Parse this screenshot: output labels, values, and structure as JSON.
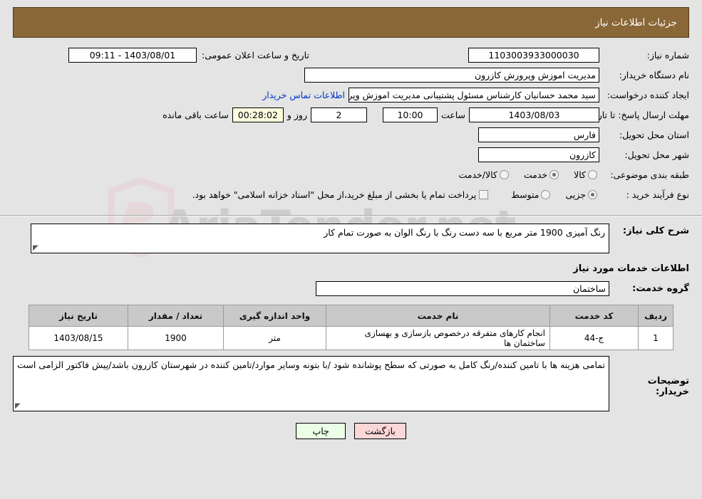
{
  "header": {
    "title": "جزئیات اطلاعات نیاز"
  },
  "colors": {
    "header_bg": "#8a6736",
    "page_bg": "#e4e4e4",
    "link": "#0033cc",
    "countdown_bg": "#ffffe0",
    "table_header_bg": "#c9c9c9",
    "print_button_bg": "#eaffe6",
    "back_button_bg": "#fcd7d7"
  },
  "info": {
    "need_number_label": "شماره نیاز:",
    "need_number_value": "1103003933000030",
    "announce_datetime_label": "تاریخ و ساعت اعلان عمومی:",
    "announce_datetime_value": "1403/08/01 - 09:11",
    "buyer_org_label": "نام دستگاه خریدار:",
    "buyer_org_value": "مدیریت اموزش وپرورش کازرون",
    "creator_label": "ایجاد کننده درخواست:",
    "creator_value": "سید محمد  حسانیان  کارشناس مسئول پشتیبانی مدیریت اموزش وپرورش کازرو",
    "buyer_contact_link": "اطلاعات تماس خریدار",
    "deadline_label": "مهلت ارسال پاسخ: تا تاریخ:",
    "deadline_date_value": "1403/08/03",
    "hour_label": "ساعت",
    "deadline_time_value": "10:00",
    "days_value": "2",
    "days_label": "روز و",
    "countdown_value": "00:28:02",
    "remaining_label": "ساعت باقی مانده",
    "province_label": "استان محل تحویل:",
    "province_value": "فارس",
    "city_label": "شهر محل تحویل:",
    "city_value": "کازرون",
    "category_label": "طبقه بندی موضوعی:",
    "category_options": [
      {
        "label": "کالا",
        "selected": false
      },
      {
        "label": "خدمت",
        "selected": true
      },
      {
        "label": "کالا/خدمت",
        "selected": false
      }
    ],
    "purchase_type_label": "نوع فرآیند خرید :",
    "purchase_type_options": [
      {
        "label": "جزیی",
        "selected": true
      },
      {
        "label": "متوسط",
        "selected": false
      }
    ],
    "treasury_note": "پرداخت تمام یا بخشی از مبلغ خرید،از محل \"اسناد خزانه اسلامی\" خواهد بود.",
    "treasury_checked": false
  },
  "description": {
    "label": "شرح کلی نیاز:",
    "value": "رنگ آمیزی 1900 متر مربع با سه دست رنگ با رنگ الوان به صورت تمام کار"
  },
  "services": {
    "section_title": "اطلاعات خدمات مورد نیاز",
    "group_label": "گروه خدمت:",
    "group_value": "ساختمان",
    "columns": [
      "ردیف",
      "کد خدمت",
      "نام خدمت",
      "واحد اندازه گیری",
      "تعداد / مقدار",
      "تاریخ نیاز"
    ],
    "rows": [
      {
        "index": "1",
        "code": "ج-44",
        "name": "انجام کارهای متفرقه درخصوص بازسازی و بهسازی ساختمان ها",
        "unit": "متر",
        "quantity": "1900",
        "need_date": "1403/08/15"
      }
    ]
  },
  "buyer_notes": {
    "label": "توضیحات خریدار:",
    "value": "تمامی هزینه ها با تامین کننده/رنگ کامل به صورتی که سطح پوشانده شود /با بتونه وسایر موارد/تامین کننده در شهرستان کازرون باشد/پیش فاکتور الزامی است"
  },
  "footer": {
    "print_label": "چاپ",
    "back_label": "بازگشت"
  },
  "watermark": {
    "text": "AriaTender.net"
  }
}
